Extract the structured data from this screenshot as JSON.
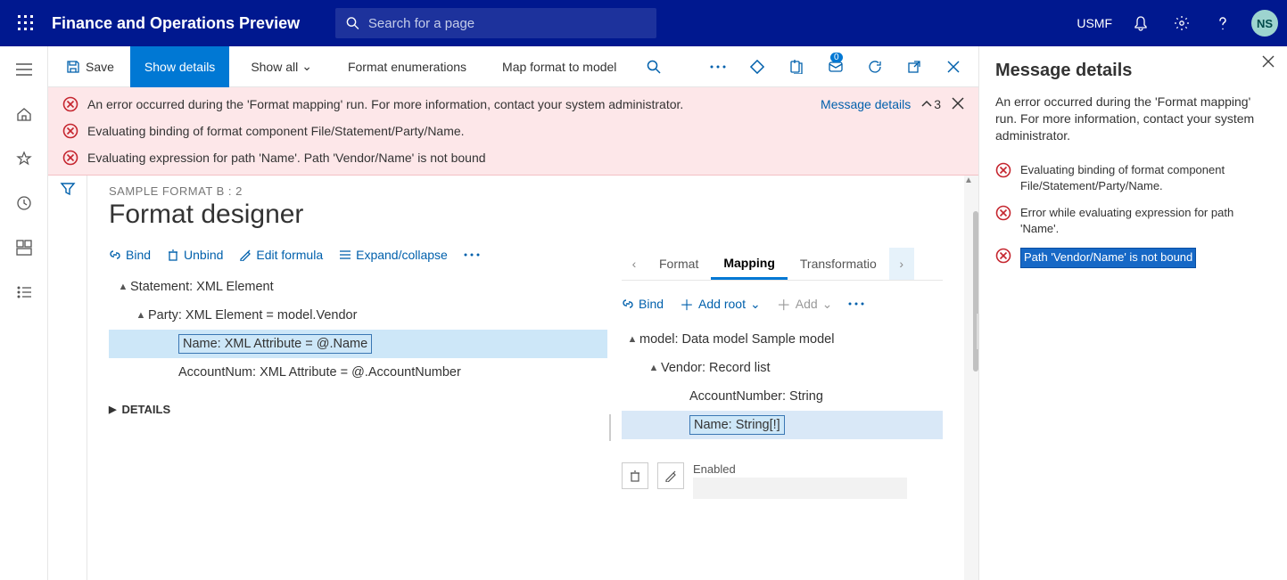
{
  "header": {
    "app_title": "Finance and Operations Preview",
    "search_placeholder": "Search for a page",
    "company": "USMF",
    "avatar_initials": "NS"
  },
  "action_bar": {
    "save": "Save",
    "show_details": "Show details",
    "show_all": "Show all",
    "format_enum": "Format enumerations",
    "map_format": "Map format to model",
    "badge_count": "0"
  },
  "errors": {
    "row1": "An error occurred during the 'Format mapping' run. For more information, contact your system administrator.",
    "row2": "Evaluating binding of format component File/Statement/Party/Name.",
    "row3": "Evaluating expression for path 'Name'.   Path 'Vendor/Name' is not bound",
    "message_details_link": "Message details",
    "count": "3"
  },
  "designer": {
    "breadcrumb": "SAMPLE FORMAT B : 2",
    "title": "Format designer",
    "toolbar": {
      "bind": "Bind",
      "unbind": "Unbind",
      "edit_formula": "Edit formula",
      "expand": "Expand/collapse"
    },
    "tree": {
      "statement": "Statement: XML Element",
      "party": "Party: XML Element = model.Vendor",
      "name": "Name: XML Attribute = @.Name",
      "account": "AccountNum: XML Attribute = @.AccountNumber"
    },
    "details_label": "DETAILS"
  },
  "right_pane": {
    "tabs": {
      "format": "Format",
      "mapping": "Mapping",
      "transform": "Transformatio"
    },
    "toolbar": {
      "bind": "Bind",
      "add_root": "Add root",
      "add": "Add"
    },
    "tree": {
      "model": "model: Data model Sample model",
      "vendor": "Vendor: Record list",
      "account_number": "AccountNumber: String",
      "name": "Name: String[!]"
    },
    "prop_label": "Enabled"
  },
  "msg_panel": {
    "title": "Message details",
    "summary": "An error occurred during the 'Format mapping' run. For more information, contact your system administrator.",
    "items": [
      "Evaluating binding of format component File/Statement/Party/Name.",
      "Error while evaluating expression for path 'Name'.",
      "Path 'Vendor/Name' is not bound"
    ]
  }
}
